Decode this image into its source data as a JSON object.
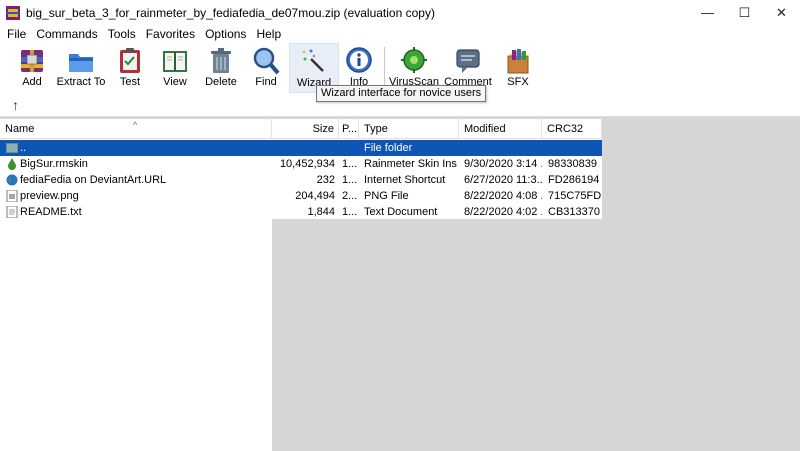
{
  "window": {
    "title": "big_sur_beta_3_for_rainmeter_by_fediafedia_de07mou.zip (evaluation copy)",
    "minimize_glyph": "—",
    "maximize_glyph": "☐",
    "close_glyph": "✕"
  },
  "menu": [
    "File",
    "Commands",
    "Tools",
    "Favorites",
    "Options",
    "Help"
  ],
  "toolbar": {
    "buttons": [
      {
        "label": "Add",
        "icon": "add-archive-icon"
      },
      {
        "label": "Extract To",
        "icon": "extract-folder-icon"
      },
      {
        "label": "Test",
        "icon": "test-clipboard-icon"
      },
      {
        "label": "View",
        "icon": "view-book-icon"
      },
      {
        "label": "Delete",
        "icon": "trash-icon"
      },
      {
        "label": "Find",
        "icon": "magnifier-icon"
      },
      {
        "label": "Wizard",
        "icon": "wand-icon"
      },
      {
        "label": "Info",
        "icon": "info-icon"
      },
      {
        "label": "VirusScan",
        "icon": "virus-scan-icon"
      },
      {
        "label": "Comment",
        "icon": "comment-icon"
      },
      {
        "label": "SFX",
        "icon": "sfx-icon"
      }
    ],
    "tooltip": "Wizard interface for novice users"
  },
  "address": {
    "up_glyph": "↑"
  },
  "columns": {
    "name": "Name",
    "size": "Size",
    "packed": "P...",
    "type": "Type",
    "modified": "Modified",
    "crc": "CRC32",
    "sort_glyph": "^"
  },
  "files": [
    {
      "name": "..",
      "size": "",
      "packed": "",
      "type": "File folder",
      "modified": "",
      "crc": "",
      "icon": "folder-up-icon",
      "selected": true
    },
    {
      "name": "BigSur.rmskin",
      "size": "10,452,934",
      "packed": "1...",
      "type": "Rainmeter Skin Ins...",
      "modified": "9/30/2020 3:14 ...",
      "crc": "98330839",
      "icon": "rainmeter-drop-icon",
      "selected": false
    },
    {
      "name": "fediaFedia on DeviantArt.URL",
      "size": "232",
      "packed": "1...",
      "type": "Internet Shortcut",
      "modified": "6/27/2020 11:3...",
      "crc": "FD286194",
      "icon": "globe-icon",
      "selected": false
    },
    {
      "name": "preview.png",
      "size": "204,494",
      "packed": "2...",
      "type": "PNG File",
      "modified": "8/22/2020 4:08 ...",
      "crc": "715C75FD",
      "icon": "image-file-icon",
      "selected": false
    },
    {
      "name": "README.txt",
      "size": "1,844",
      "packed": "1...",
      "type": "Text Document",
      "modified": "8/22/2020 4:02 ...",
      "crc": "CB313370",
      "icon": "text-file-icon",
      "selected": false
    }
  ],
  "colors": {
    "selection": "#0f55b5",
    "background_gray": "#d6d6d6"
  }
}
